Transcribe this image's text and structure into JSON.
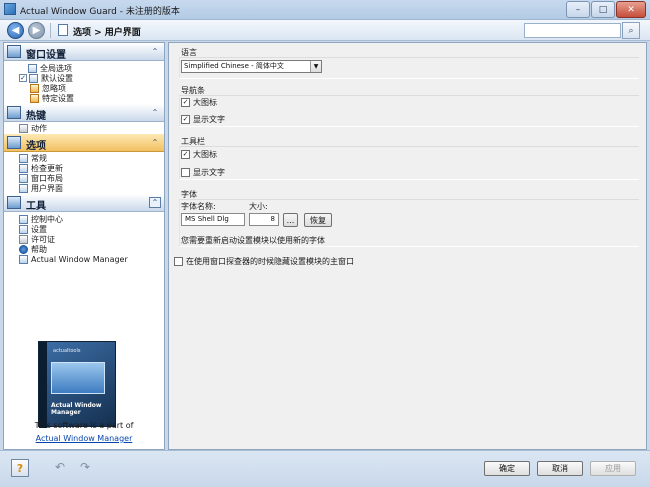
{
  "window": {
    "title": "Actual Window Guard - 未注册的版本",
    "controls": {
      "minimize": "–",
      "maximize": "□",
      "close": "✕"
    }
  },
  "nav": {
    "breadcrumb": "选项 > 用户界面",
    "search": {
      "value": "",
      "placeholder": ""
    }
  },
  "sidebar": {
    "sections": [
      {
        "label": "窗口设置",
        "collapse": "⌃",
        "items": [
          {
            "label": "全局选项",
            "icon": "global-options-icon"
          },
          {
            "label": "默认设置",
            "icon": "default-settings-icon",
            "checkbox": "✓"
          },
          {
            "label": "忽略项",
            "icon": "ignore-icon"
          },
          {
            "label": "特定设置",
            "icon": "specific-settings-icon"
          }
        ]
      },
      {
        "label": "热键",
        "collapse": "⌃",
        "items": [
          {
            "label": "动作",
            "icon": "action-icon"
          }
        ]
      },
      {
        "label": "选项",
        "collapse": "⌃",
        "items": [
          {
            "label": "常规",
            "icon": "general-icon"
          },
          {
            "label": "检查更新",
            "icon": "check-updates-icon"
          },
          {
            "label": "窗口布局",
            "icon": "window-layout-icon"
          },
          {
            "label": "用户界面",
            "icon": "user-interface-icon"
          }
        ]
      },
      {
        "label": "工具",
        "collapse": "⌃",
        "items": [
          {
            "label": "控制中心",
            "icon": "control-center-icon"
          },
          {
            "label": "设置",
            "icon": "settings-icon"
          },
          {
            "label": "许可证",
            "icon": "license-icon"
          },
          {
            "label": "帮助",
            "icon": "help-icon"
          },
          {
            "label": "Actual Window Manager",
            "icon": "window-manager-icon"
          }
        ]
      }
    ],
    "promo": {
      "text": "This software is a part of",
      "link": "Actual Window Manager",
      "box_brand": "actualtools",
      "box_product": "Actual Window Manager"
    }
  },
  "main": {
    "language": {
      "title": "语言",
      "value": "Simplified Chinese - 简体中文"
    },
    "navbar_group": {
      "title": "导航条",
      "large_icons": "大图标",
      "show_text": "显示文字"
    },
    "toolbar_group": {
      "title": "工具栏",
      "large_icons": "大图标",
      "show_text": "显示文字"
    },
    "font_group": {
      "title": "字体",
      "name_label": "字体名称:",
      "size_label": "大小:",
      "name_value": "MS Shell Dlg",
      "size_value": "8",
      "browse": "...",
      "restore": "恢复",
      "note": "您需要重新启动设置模块以使用新的字体"
    },
    "hide_option": "在使用窗口探查器的时候隐藏设置模块的主窗口"
  },
  "footer": {
    "help": "?",
    "undo": "↶",
    "redo": "↷",
    "ok": "确定",
    "cancel": "取消",
    "apply": "应用"
  }
}
